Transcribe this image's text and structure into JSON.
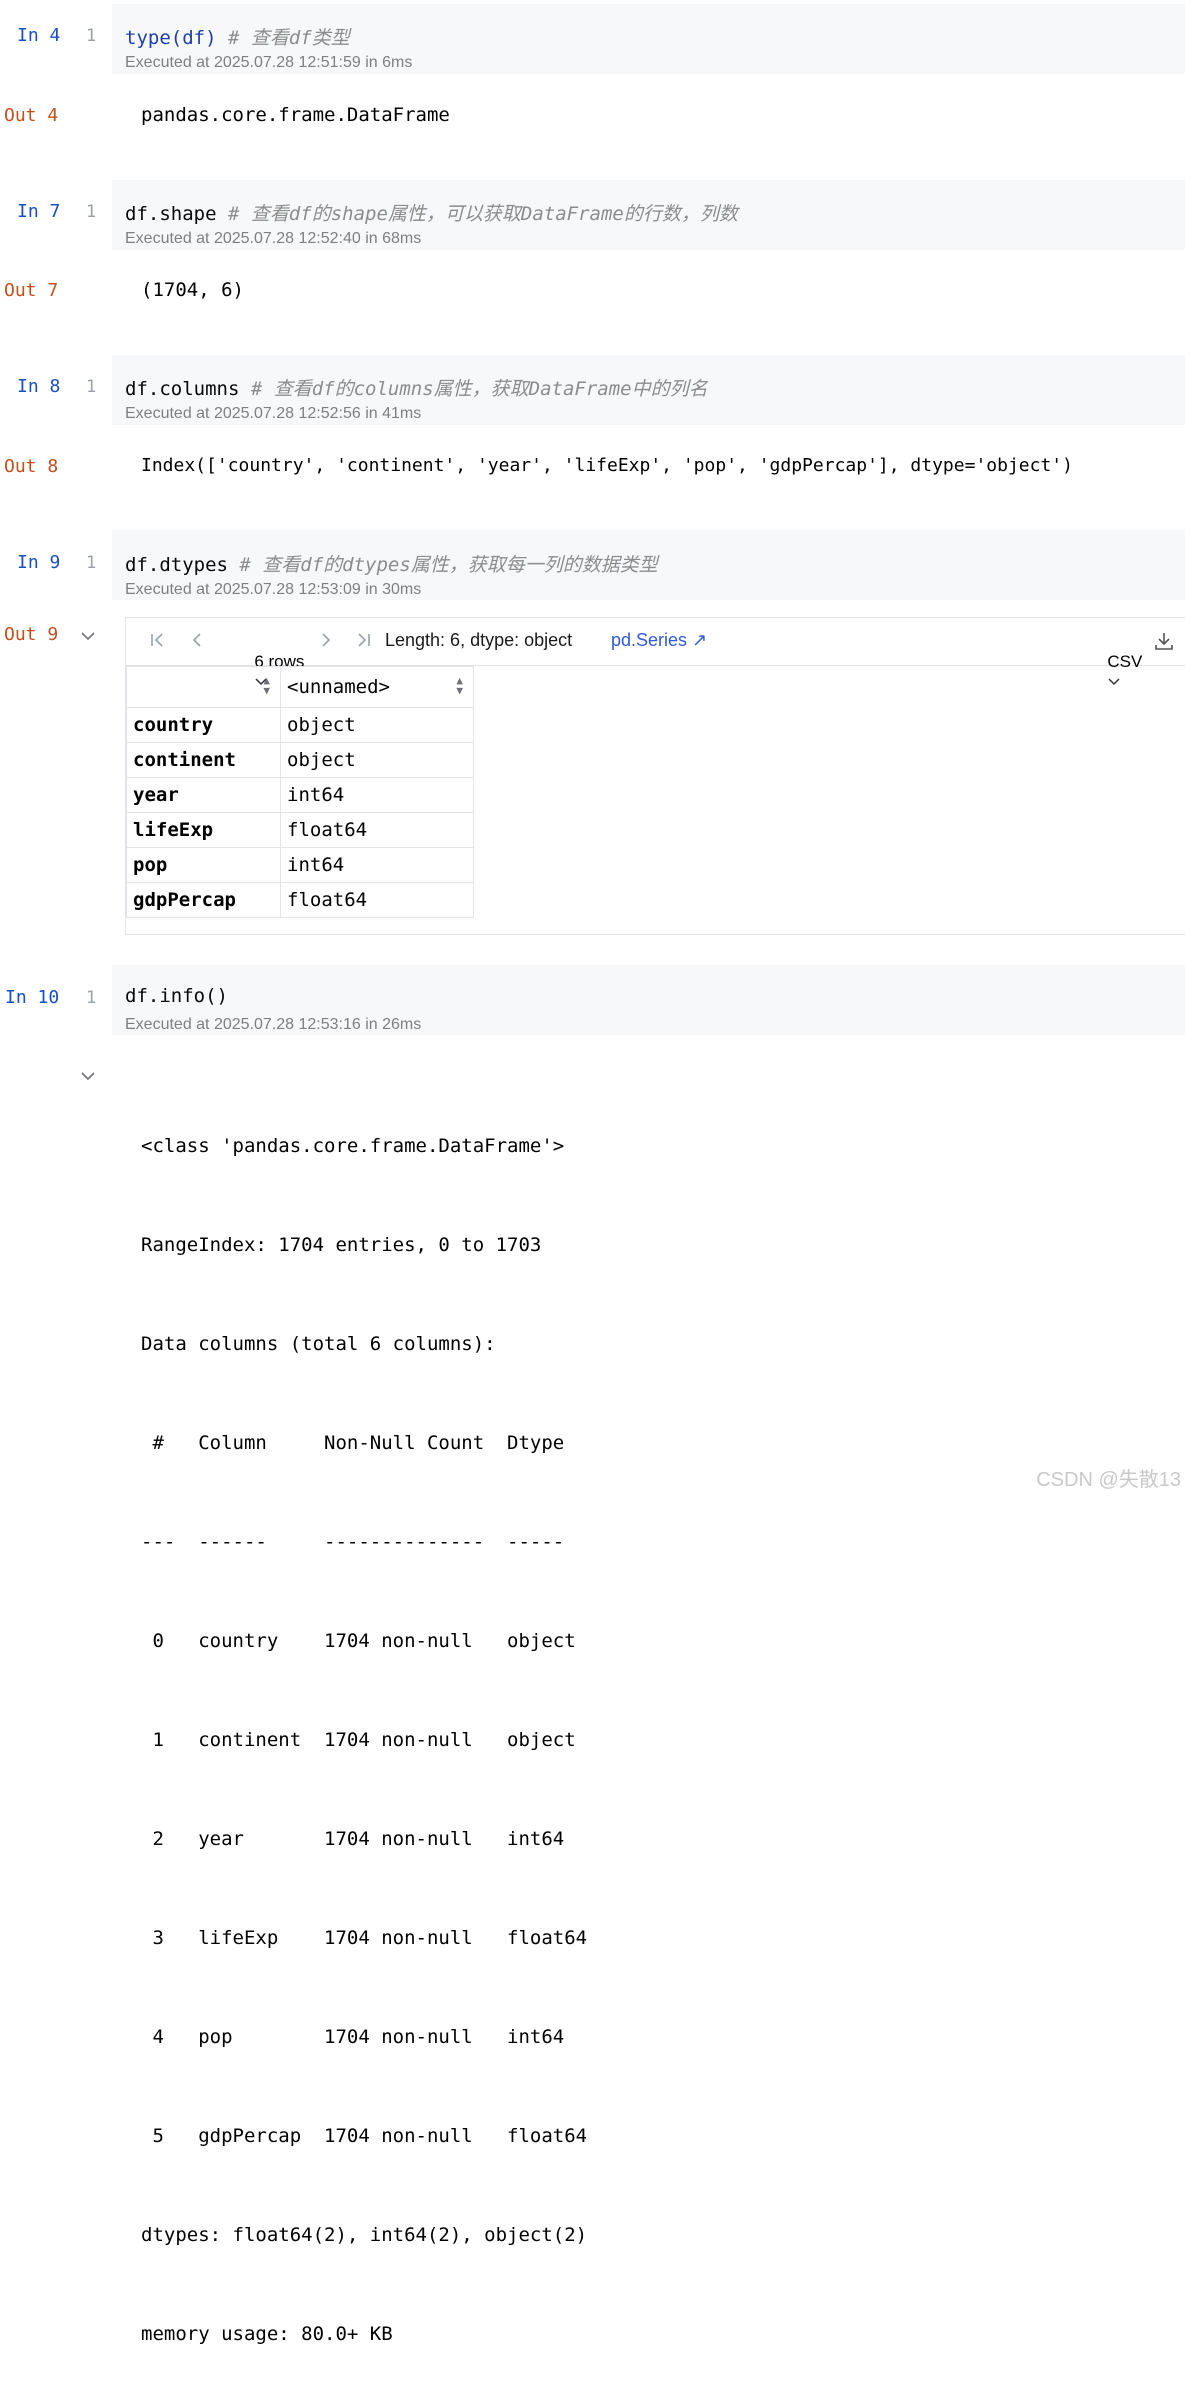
{
  "cells": [
    {
      "in_label": "In 4",
      "line": "1",
      "code": "type(df)",
      "comment": "# 查看df类型",
      "exec": "Executed at 2025.07.28 12:51:59 in 6ms",
      "out_label": "Out 4",
      "output": "pandas.core.frame.DataFrame"
    },
    {
      "in_label": "In 7",
      "line": "1",
      "code": "df.shape",
      "comment": "# 查看df的shape属性，可以获取DataFrame的行数，列数",
      "exec": "Executed at 2025.07.28 12:52:40 in 68ms",
      "out_label": "Out 7",
      "output": "(1704, 6)"
    },
    {
      "in_label": "In 8",
      "line": "1",
      "code": "df.columns",
      "comment": "# 查看df的columns属性，获取DataFrame中的列名",
      "exec": "Executed at 2025.07.28 12:52:56 in 41ms",
      "out_label": "Out 8",
      "output": "Index(['country', 'continent', 'year', 'lifeExp', 'pop', 'gdpPercap'], dtype='object')"
    },
    {
      "in_label": "In 9",
      "line": "1",
      "code": "df.dtypes",
      "comment": "# 查看df的dtypes属性，获取每一列的数据类型",
      "exec": "Executed at 2025.07.28 12:53:09 in 30ms",
      "out_label": "Out 9"
    },
    {
      "in_label": "In 10",
      "line": "1",
      "code": "df.info()",
      "comment": "",
      "exec": "Executed at 2025.07.28 12:53:16 in 26ms"
    }
  ],
  "table": {
    "rows_label": "6 rows",
    "length_text": "Length: 6, dtype: object",
    "series_link": "pd.Series ↗",
    "csv_label": "CSV",
    "header": "<unnamed>",
    "rows": [
      {
        "name": "country",
        "value": "object"
      },
      {
        "name": "continent",
        "value": "object"
      },
      {
        "name": "year",
        "value": "int64"
      },
      {
        "name": "lifeExp",
        "value": "float64"
      },
      {
        "name": "pop",
        "value": "int64"
      },
      {
        "name": "gdpPercap",
        "value": "float64"
      }
    ]
  },
  "info_output": [
    "<class 'pandas.core.frame.DataFrame'>",
    "RangeIndex: 1704 entries, 0 to 1703",
    "Data columns (total 6 columns):",
    " #   Column     Non-Null Count  Dtype  ",
    "---  ------     --------------  -----  ",
    " 0   country    1704 non-null   object ",
    " 1   continent  1704 non-null   object ",
    " 2   year       1704 non-null   int64  ",
    " 3   lifeExp    1704 non-null   float64",
    " 4   pop        1704 non-null   int64  ",
    " 5   gdpPercap  1704 non-null   float64",
    "dtypes: float64(2), int64(2), object(2)",
    "memory usage: 80.0+ KB"
  ],
  "watermark": "CSDN @失散13",
  "icons": {
    "first": "first-page-icon",
    "prev": "prev-page-icon",
    "next": "next-page-icon",
    "last": "last-page-icon",
    "download": "download-icon",
    "collapse": "chevron-down-icon"
  },
  "colors": {
    "in_label": "#1a4fc4",
    "out_label": "#c24f1c",
    "code_bg": "#f7f8fa",
    "link": "#2f5bd6"
  }
}
